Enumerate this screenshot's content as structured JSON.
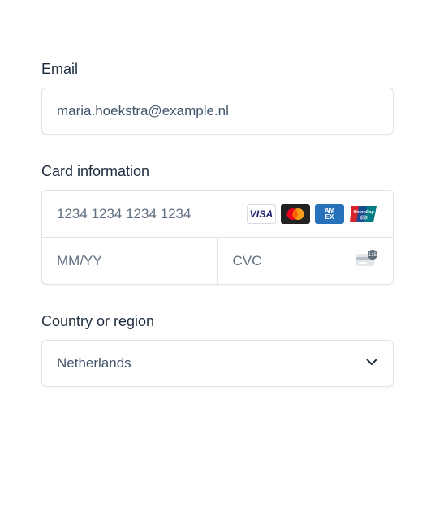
{
  "email": {
    "label": "Email",
    "value": "maria.hoekstra@example.nl"
  },
  "card": {
    "label": "Card information",
    "number_placeholder": "1234 1234 1234 1234",
    "expiry_placeholder": "MM/YY",
    "cvc_placeholder": "CVC",
    "brands": [
      "visa-icon",
      "mastercard-icon",
      "amex-icon",
      "unionpay-icon"
    ],
    "brand_visa_text": "VISA",
    "brand_amex_text": "AM EX",
    "cvc_icon_text": "135"
  },
  "country": {
    "label": "Country or region",
    "value": "Netherlands"
  },
  "colors": {
    "label": "#1d2d3f",
    "border": "#e0e3e8",
    "visa": "#1a1f71",
    "amex": "#2671b9",
    "mc_red": "#eb001b",
    "mc_yellow": "#f79e1b"
  }
}
